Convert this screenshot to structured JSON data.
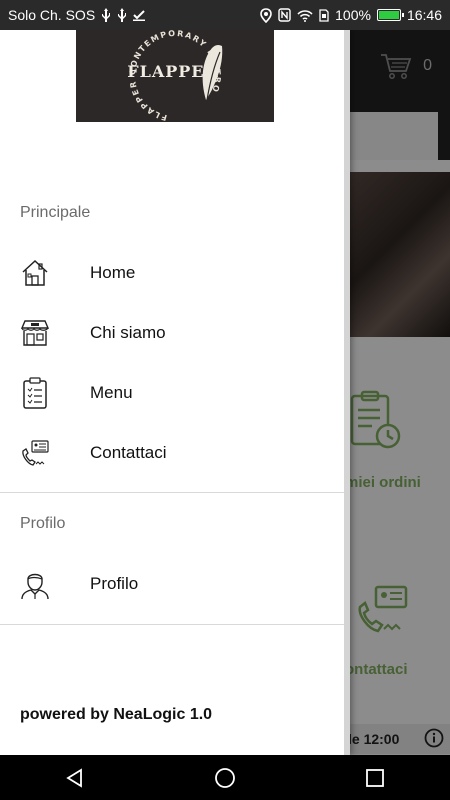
{
  "status_bar": {
    "carrier": "Solo Ch. SOS",
    "battery": "100%",
    "time": "16:46"
  },
  "background_app": {
    "cart_count": "0",
    "orders_label": "miei ordini",
    "contacts_label": "ontattaci",
    "hours_text": "le 12:00"
  },
  "logo": {
    "brand": "FLAPPER",
    "ring_text": "FLAPPER CONTEMPORARY BISTRO"
  },
  "drawer": {
    "section_main": "Principale",
    "main_items": [
      {
        "label": "Home",
        "icon": "home-icon"
      },
      {
        "label": "Chi siamo",
        "icon": "store-icon"
      },
      {
        "label": "Menu",
        "icon": "clipboard-list-icon"
      },
      {
        "label": "Contattaci",
        "icon": "phone-contact-icon"
      }
    ],
    "section_profile": "Profilo",
    "profile_items": [
      {
        "label": "Profilo",
        "icon": "user-icon"
      }
    ],
    "footer": "powered by NeaLogic 1.0"
  },
  "colors": {
    "accent_green": "#7aa55a",
    "drawer_bg": "#ffffff",
    "section_text": "#6b6b6b"
  }
}
